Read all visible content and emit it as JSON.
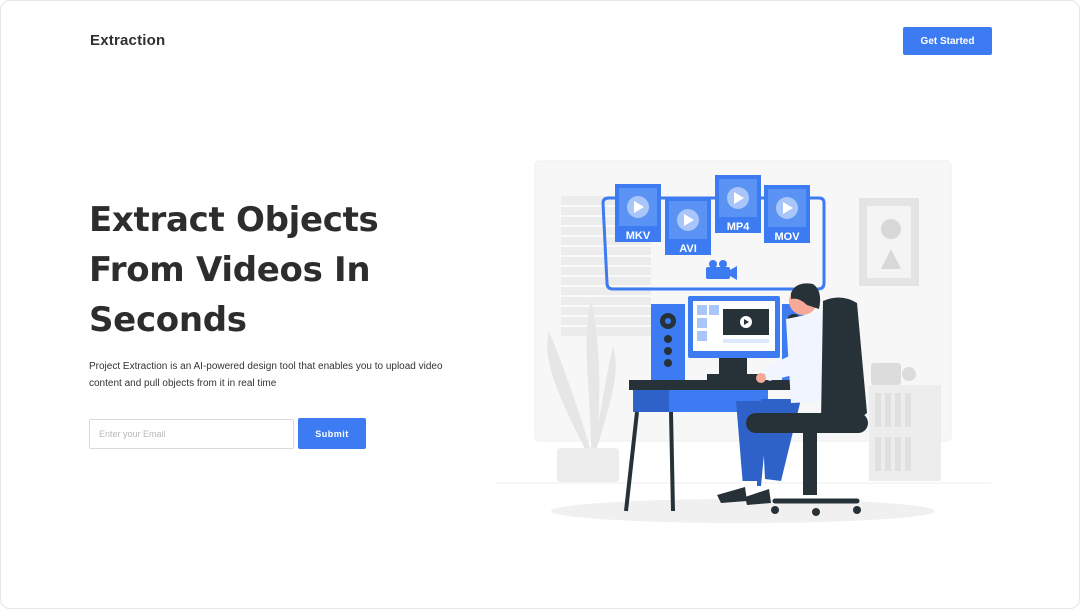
{
  "header": {
    "brand": "Extraction",
    "cta_label": "Get Started"
  },
  "hero": {
    "headline": "Extract Objects From Videos In Seconds",
    "description": "Project Extraction is an AI-powered design tool that enables you to upload video content and pull objects from it in real time",
    "email_placeholder": "Enter your Email",
    "submit_label": "Submit"
  },
  "illustration": {
    "formats": [
      "MKV",
      "AVI",
      "MP4",
      "MOV"
    ],
    "icons": [
      "play-icon",
      "video-camera-icon"
    ]
  },
  "colors": {
    "accent": "#3d7bf3",
    "text": "#2d2d2d",
    "illustration_gray": "#e8e8e8",
    "chair": "#263238"
  }
}
